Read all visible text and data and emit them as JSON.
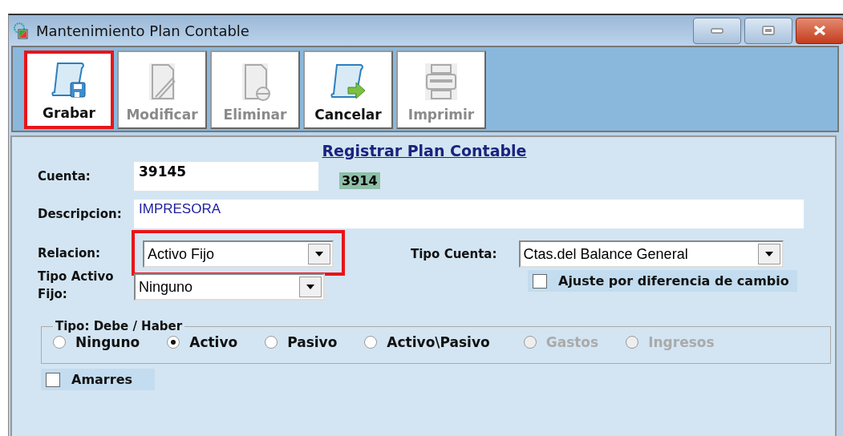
{
  "window": {
    "title": "Mantenimiento Plan Contable"
  },
  "toolbar": [
    {
      "label": "Grabar",
      "kind": "save",
      "disabled": false,
      "highlighted": true
    },
    {
      "label": "Modificar",
      "kind": "edit",
      "disabled": true,
      "highlighted": false
    },
    {
      "label": "Eliminar",
      "kind": "delete",
      "disabled": true,
      "highlighted": false
    },
    {
      "label": "Cancelar",
      "kind": "cancel",
      "disabled": false,
      "highlighted": false
    },
    {
      "label": "Imprimir",
      "kind": "print",
      "disabled": true,
      "highlighted": false
    }
  ],
  "form": {
    "heading": "Registrar Plan Contable",
    "cuenta": {
      "label": "Cuenta:",
      "value": "39145",
      "parent": "3914"
    },
    "descripcion": {
      "label": "Descripcion:",
      "value": "IMPRESORA"
    },
    "relacion": {
      "label": "Relacion:",
      "value": "Activo Fijo",
      "highlighted": true
    },
    "tipo_cuenta": {
      "label": "Tipo Cuenta:",
      "value": "Ctas.del Balance General"
    },
    "ajuste": {
      "label": "Ajuste por diferencia de cambio",
      "checked": false
    },
    "tipo_activo_fijo": {
      "label": "Tipo Activo Fijo:",
      "value": "Ninguno"
    },
    "debe_haber": {
      "legend": "Tipo: Debe / Haber",
      "options": [
        {
          "label": "Ninguno",
          "selected": false,
          "disabled": false
        },
        {
          "label": "Activo",
          "selected": true,
          "disabled": false
        },
        {
          "label": "Pasivo",
          "selected": false,
          "disabled": false
        },
        {
          "label": "Activo\\Pasivo",
          "selected": false,
          "disabled": false
        },
        {
          "label": "Gastos",
          "selected": false,
          "disabled": true
        },
        {
          "label": "Ingresos",
          "selected": false,
          "disabled": true
        }
      ]
    },
    "amarres": {
      "label": "Amarres",
      "checked": false
    }
  }
}
